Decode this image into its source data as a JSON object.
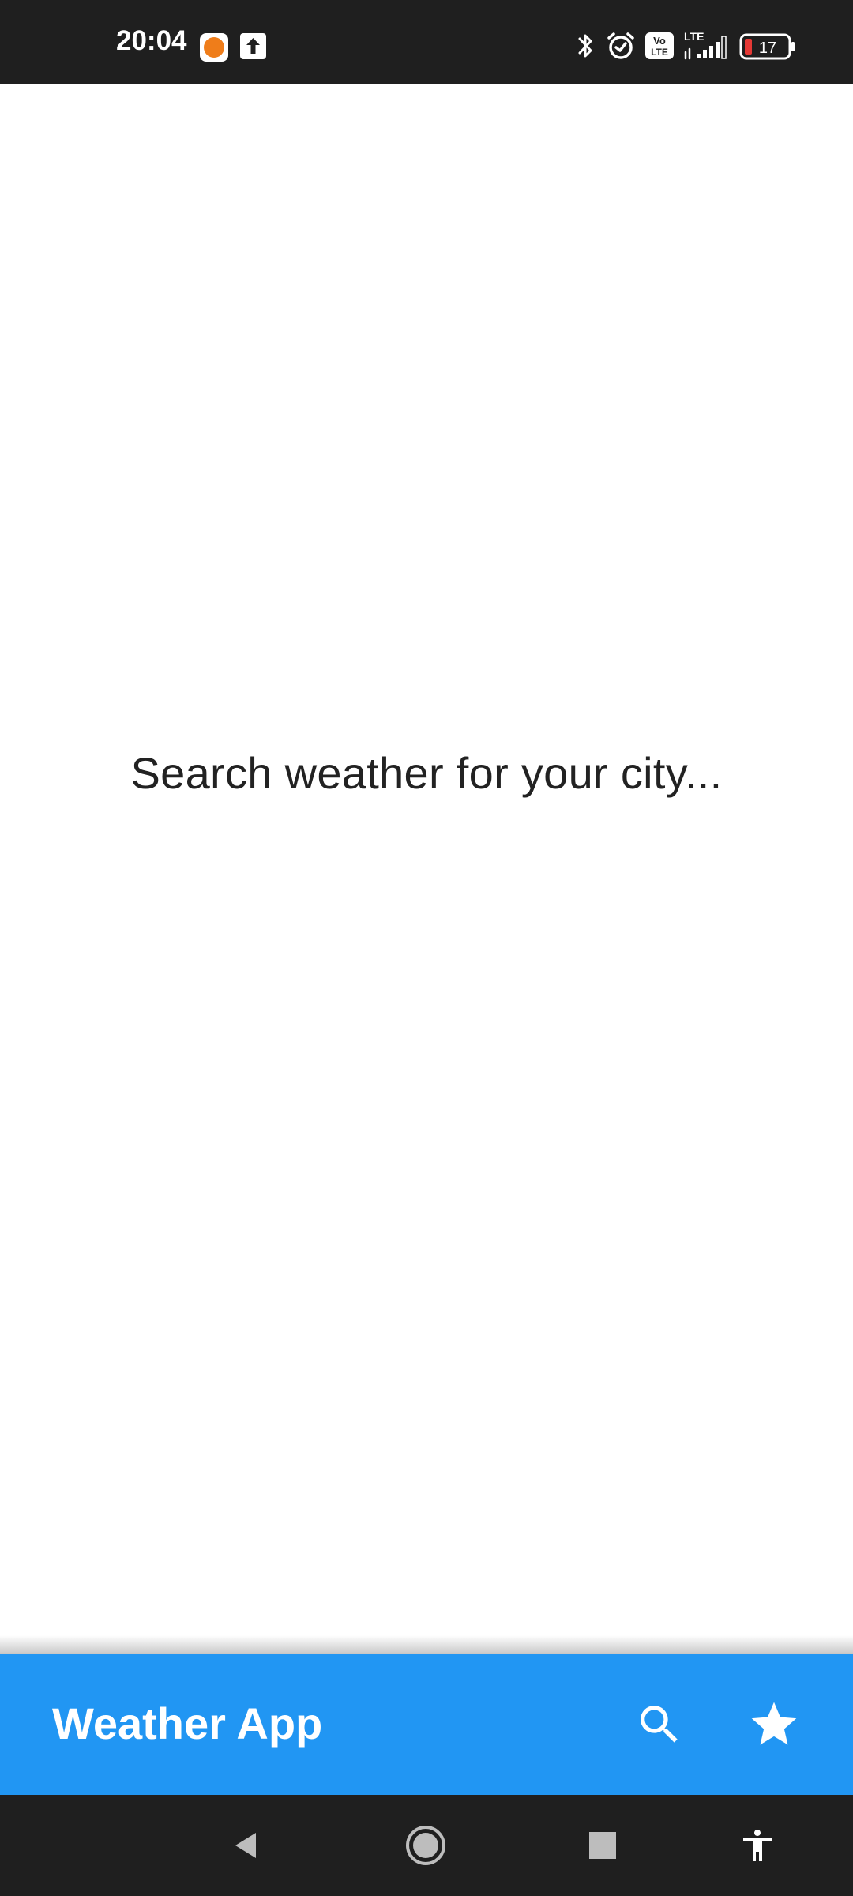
{
  "status_bar": {
    "time": "20:04",
    "battery_level": "17",
    "network_type": "LTE",
    "volte_label_top": "Vo",
    "volte_label_bottom": "LTE",
    "icons": [
      "app-notification-icon",
      "upload-icon",
      "bluetooth-icon",
      "alarm-icon",
      "volte-icon",
      "signal-icon",
      "battery-icon"
    ]
  },
  "main": {
    "empty_message": "Search weather for your city..."
  },
  "app_bar": {
    "title": "Weather App",
    "actions": [
      "search-icon",
      "star-icon"
    ]
  },
  "nav_bar": {
    "buttons": [
      "back-icon",
      "home-icon",
      "recents-icon",
      "accessibility-icon"
    ]
  },
  "colors": {
    "app_bar": "#2196f3",
    "status_bar": "#1f1f1f",
    "nav_bar": "#1f1f1f",
    "text": "#222222",
    "app_icon_accent": "#ef7d1a",
    "battery_low": "#e53935"
  }
}
